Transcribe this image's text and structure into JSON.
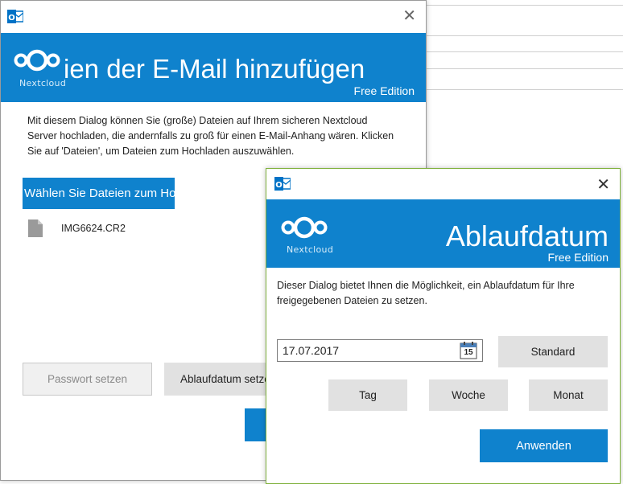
{
  "main_dialog": {
    "banner_title": "ien der E-Mail hinzufügen",
    "edition": "Free Edition",
    "logo_text": "Nextcloud",
    "description": "Mit diesem Dialog können Sie (große) Dateien auf Ihrem sicheren Nextcloud Server hochladen, die andernfalls zu groß für einen E-Mail-Anhang wären. Klicken Sie auf 'Dateien', um Dateien zum Hochladen auszuwählen.",
    "select_files_label": "Wählen Sie Dateien zum Ho",
    "file_name": "IMG6624.CR2",
    "password_button": "Passwort setzen",
    "expiry_button": "Ablaufdatum setzen"
  },
  "expiry_dialog": {
    "banner_title": "Ablaufdatum",
    "edition": "Free Edition",
    "logo_text": "Nextcloud",
    "description": "Dieser Dialog bietet Ihnen die Möglichkeit, ein Ablaufdatum für Ihre freigegebenen Dateien zu setzen.",
    "date_value": "17.07.2017",
    "calendar_day": "15",
    "standard_button": "Standard",
    "day_button": "Tag",
    "week_button": "Woche",
    "month_button": "Monat",
    "apply_button": "Anwenden"
  },
  "colors": {
    "brand_blue": "#0f82cd",
    "button_gray": "#e1e1e1",
    "outlook_blue": "#0072c6"
  }
}
